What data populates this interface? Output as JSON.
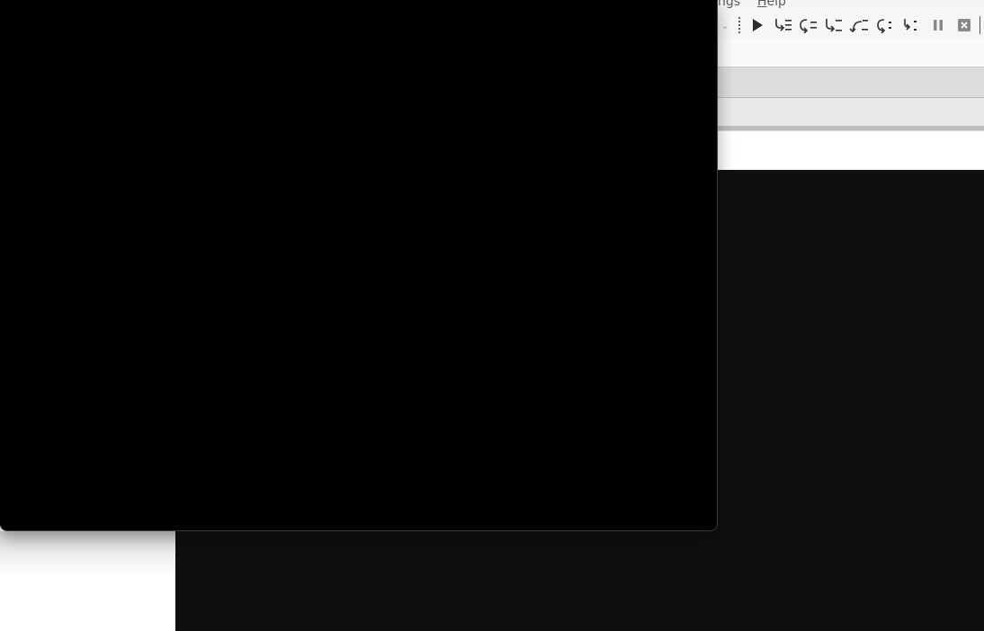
{
  "menubar": {
    "items": [
      {
        "label": "ngs"
      },
      {
        "label": "Help",
        "mnemonic": "H",
        "rest": "elp"
      }
    ]
  },
  "toolbar": {
    "buttons": [
      {
        "name": "run",
        "icon": "play-icon"
      },
      {
        "name": "step-into",
        "icon": "step-into-icon"
      },
      {
        "name": "step-over",
        "icon": "step-over-icon"
      },
      {
        "name": "step-out",
        "icon": "step-out-icon"
      },
      {
        "name": "step-back",
        "icon": "step-back-icon"
      },
      {
        "name": "continue",
        "icon": "continue-icon"
      },
      {
        "name": "run-to-cursor",
        "icon": "run-to-cursor-icon"
      },
      {
        "name": "pause",
        "icon": "pause-icon"
      },
      {
        "name": "stop",
        "icon": "stop-icon"
      }
    ]
  },
  "colors": {
    "foreground_window": "#000000",
    "console_background": "#0f0f0f",
    "toolbar_background": "#f6f6f6"
  }
}
